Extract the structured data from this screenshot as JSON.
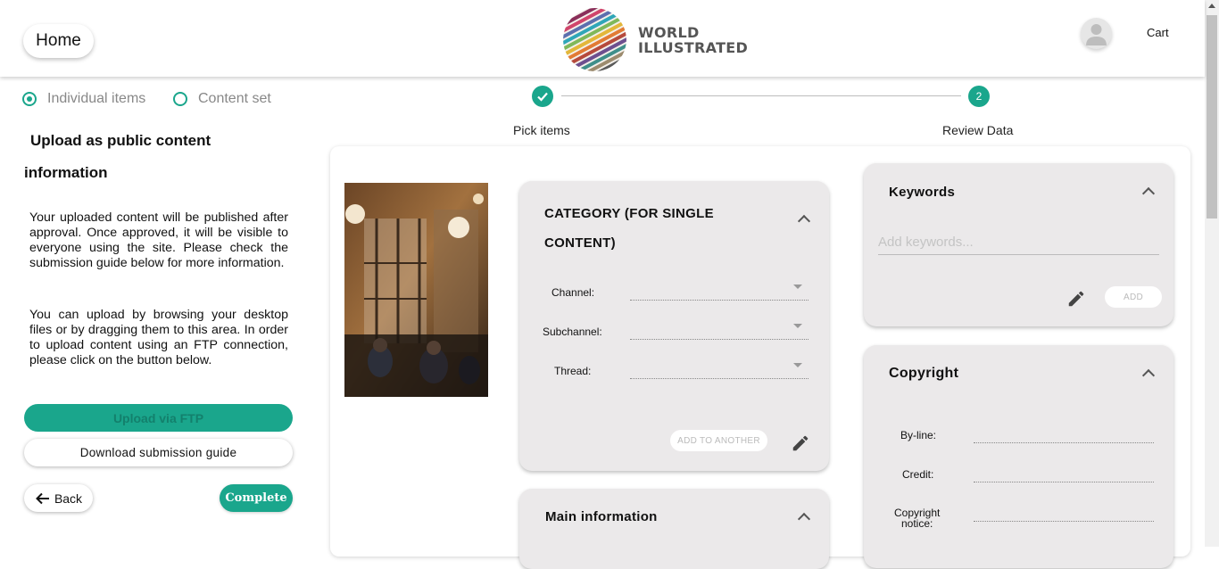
{
  "header": {
    "home_label": "Home",
    "logo_line1": "WORLD",
    "logo_line2": "ILLUSTRATED",
    "cart_label": "Cart"
  },
  "upload_mode": {
    "options": [
      {
        "label": "Individual items",
        "selected": true
      },
      {
        "label": "Content set",
        "selected": false
      }
    ]
  },
  "sidebar": {
    "title_line1": "Upload as public content",
    "title_line2": "information",
    "paragraph1": "Your uploaded content will be published after approval. Once approved, it will be visible to everyone using the site. Please check the submission guide below for more information.",
    "paragraph2": "You can upload by browsing your desktop files or by dragging them to this area. In order to upload content using an FTP connection, please click on the button below.",
    "ftp_button": "Upload via FTP",
    "guide_button": "Download submission guide",
    "back_button": "Back",
    "complete_button": "Complete"
  },
  "stepper": {
    "steps": [
      {
        "label": "Pick items",
        "state": "done"
      },
      {
        "label": "Review Data",
        "number": "2",
        "state": "active"
      }
    ]
  },
  "category_panel": {
    "title_line1": "CATEGORY (FOR SINGLE",
    "title_line2": "CONTENT)",
    "fields": [
      {
        "label": "Channel:",
        "value": ""
      },
      {
        "label": "Subchannel:",
        "value": ""
      },
      {
        "label": "Thread:",
        "value": ""
      }
    ],
    "add_button": "ADD TO ANOTHER"
  },
  "main_info_panel": {
    "title": "Main information"
  },
  "keywords_panel": {
    "title": "Keywords",
    "placeholder": "Add keywords...",
    "add_button": "ADD"
  },
  "copyright_panel": {
    "title": "Copyright",
    "fields": [
      {
        "label": "By-line:",
        "value": ""
      },
      {
        "label": "Credit:",
        "value": ""
      },
      {
        "label_line1": "Copyright",
        "label_line2": "notice:",
        "value": ""
      }
    ]
  },
  "colors": {
    "accent": "#1aa68c",
    "panel_bg": "#ebe9ea"
  }
}
